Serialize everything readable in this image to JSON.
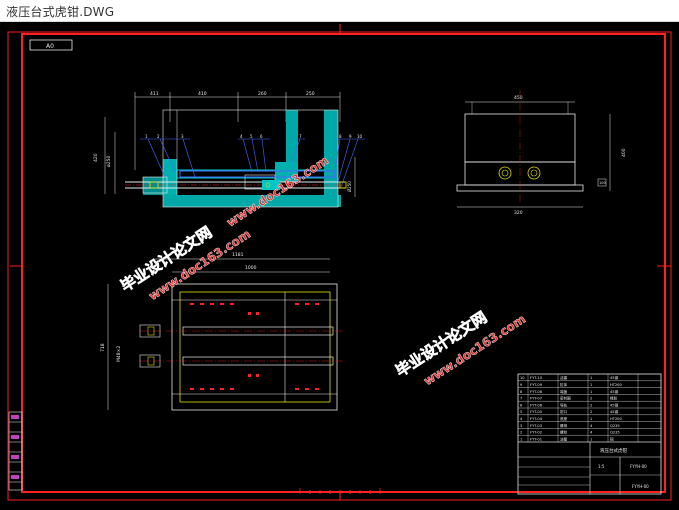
{
  "window": {
    "title": "液压台式虎钳.DWG"
  },
  "drawing": {
    "frame_tag": "A0",
    "top_view_dims": [
      "411",
      "410",
      "260",
      "250",
      "420",
      "ø250"
    ],
    "top_view_side_dims": [
      "580",
      "Ø250"
    ],
    "side_view_dims": {
      "width_top": "450",
      "height": "400",
      "base_width": "320",
      "small": "100"
    },
    "bottom_view_dims": {
      "overall": "1181",
      "inner": "1000",
      "height": "718",
      "side": "M48×2"
    },
    "balloons": [
      "1",
      "2",
      "3",
      "4",
      "5",
      "6",
      "7",
      "8",
      "9",
      "10"
    ],
    "watermark_1": {
      "cn": "毕业设计论文网",
      "url": "www.doc163.com"
    },
    "watermark_2": {
      "cn": "毕业设计论文网",
      "url": "www.doc163.com"
    },
    "title_block": {
      "drawing_title": "液压台式虎钳",
      "drawing_no": "FYYH-00",
      "scale": "1:5",
      "rows": [
        {
          "no": "10",
          "code": "FYT-10",
          "name": "活塞",
          "qty": "1",
          "mat": "45钢"
        },
        {
          "no": "9",
          "code": "FYT-09",
          "name": "缸体",
          "qty": "1",
          "mat": "HT200"
        },
        {
          "no": "8",
          "code": "FYT-08",
          "name": "端盖",
          "qty": "1",
          "mat": "45钢"
        },
        {
          "no": "7",
          "code": "FYT-07",
          "name": "密封圈",
          "qty": "2",
          "mat": "橡胶"
        },
        {
          "no": "6",
          "code": "FYT-06",
          "name": "导轨",
          "qty": "2",
          "mat": "45钢"
        },
        {
          "no": "5",
          "code": "FYT-05",
          "name": "钳口",
          "qty": "2",
          "mat": "45钢"
        },
        {
          "no": "4",
          "code": "FYT-04",
          "name": "底座",
          "qty": "1",
          "mat": "HT200"
        },
        {
          "no": "3",
          "code": "FYT-03",
          "name": "螺母",
          "qty": "4",
          "mat": "Q235"
        },
        {
          "no": "2",
          "code": "FYT-02",
          "name": "螺栓",
          "qty": "4",
          "mat": "Q235"
        },
        {
          "no": "1",
          "code": "FYT-01",
          "name": "油管",
          "qty": "1",
          "mat": "铜"
        }
      ]
    }
  },
  "colors": {
    "frame": "#ff2020",
    "line_white": "#e8e8e8",
    "cyan": "#00c8c8",
    "blue": "#4a68ff",
    "yellow": "#e0e000",
    "green": "#20d020",
    "magenta": "#c040c0",
    "watermark_cn": "#d82020",
    "watermark_url": "#e03030"
  }
}
